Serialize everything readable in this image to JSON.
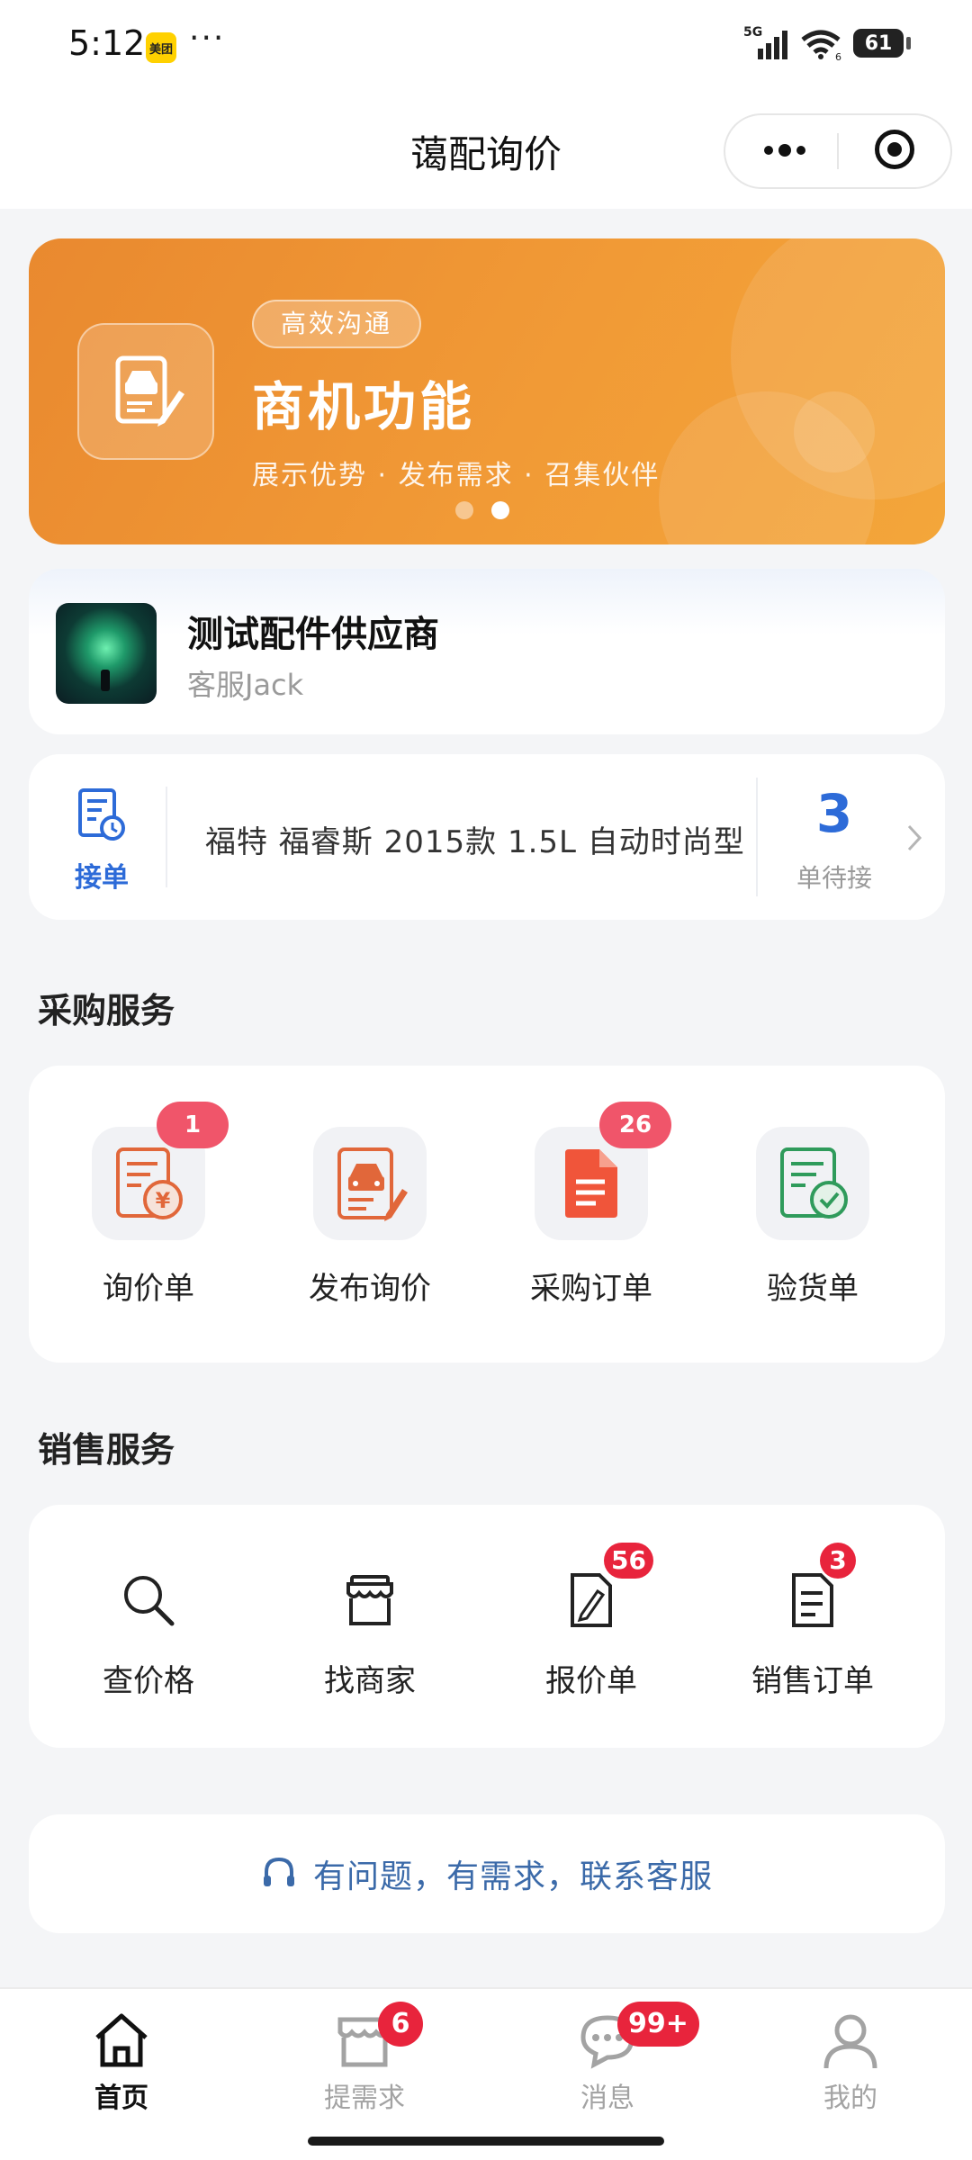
{
  "status_bar": {
    "time": "5:12",
    "app_badge": "美团",
    "more": "···",
    "network": "5G",
    "wifi_level": "6",
    "battery": "61"
  },
  "navbar": {
    "title": "蔼配询价"
  },
  "banner": {
    "tag": "高效沟通",
    "headline": "商机功能",
    "subtitle": "展示优势 · 发布需求 · 召集伙伴",
    "slide_count": 2,
    "active_slide": 2,
    "background_color": "#f19a36"
  },
  "supplier": {
    "name": "测试配件供应商",
    "role": "客服Jack"
  },
  "order_strip": {
    "action_label": "接单",
    "car_model": "福特 福睿斯 2015款 1.5L 自动时尚型",
    "count": "3",
    "count_label": "单待接",
    "accent_color": "#2d6bd8"
  },
  "purchase_section": {
    "title": "采购服务",
    "items": [
      {
        "label": "询价单",
        "icon": "inquiry-invoice-icon",
        "badge": "1"
      },
      {
        "label": "发布询价",
        "icon": "publish-inquiry-icon",
        "badge": ""
      },
      {
        "label": "采购订单",
        "icon": "purchase-order-icon",
        "badge": "26"
      },
      {
        "label": "验货单",
        "icon": "inspection-icon",
        "badge": ""
      }
    ]
  },
  "sales_section": {
    "title": "销售服务",
    "items": [
      {
        "label": "查价格",
        "icon": "search-icon",
        "badge": ""
      },
      {
        "label": "找商家",
        "icon": "store-icon",
        "badge": ""
      },
      {
        "label": "报价单",
        "icon": "quote-doc-icon",
        "badge": "56"
      },
      {
        "label": "销售订单",
        "icon": "sales-order-icon",
        "badge": "3"
      }
    ]
  },
  "service": {
    "text": "有问题，有需求，联系客服"
  },
  "tabbar": {
    "tabs": [
      {
        "label": "首页",
        "icon": "home-icon",
        "badge": "",
        "active": true
      },
      {
        "label": "提需求",
        "icon": "store-request-icon",
        "badge": "6",
        "active": false
      },
      {
        "label": "消息",
        "icon": "message-icon",
        "badge": "99+",
        "active": false
      },
      {
        "label": "我的",
        "icon": "profile-icon",
        "badge": "",
        "active": false
      }
    ]
  }
}
